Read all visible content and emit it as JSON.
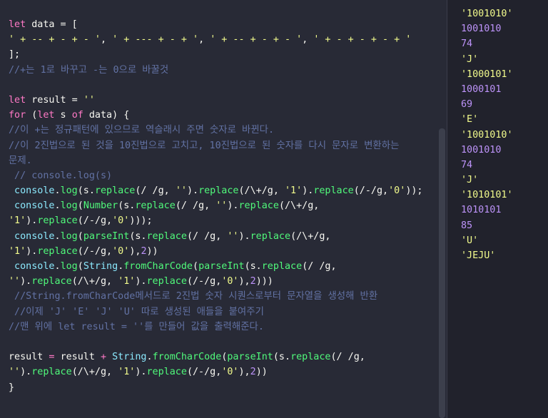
{
  "editor": {
    "lines": [
      [
        {
          "t": "let",
          "c": "kw"
        },
        {
          "t": " data = [",
          "c": "pl"
        }
      ],
      [
        {
          "t": "' + -- + - + - '",
          "c": "str"
        },
        {
          "t": ", ",
          "c": "pl"
        },
        {
          "t": "' + --- + - + '",
          "c": "str"
        },
        {
          "t": ", ",
          "c": "pl"
        },
        {
          "t": "' + -- + - + - '",
          "c": "str"
        },
        {
          "t": ", ",
          "c": "pl"
        },
        {
          "t": "' + - + - + - + '",
          "c": "str"
        }
      ],
      [
        {
          "t": "];",
          "c": "pl"
        }
      ],
      [
        {
          "t": "//+는 1로 바꾸고 -는 0으로 바꿀것",
          "c": "cm"
        }
      ],
      [],
      [
        {
          "t": "let",
          "c": "kw"
        },
        {
          "t": " result = ",
          "c": "pl"
        },
        {
          "t": "''",
          "c": "str"
        }
      ],
      [
        {
          "t": "for",
          "c": "kw"
        },
        {
          "t": " (",
          "c": "pl"
        },
        {
          "t": "let",
          "c": "kw"
        },
        {
          "t": " s ",
          "c": "pl"
        },
        {
          "t": "of",
          "c": "kw"
        },
        {
          "t": " data) {",
          "c": "pl"
        }
      ],
      [
        {
          "t": "//이 +는 정규패턴에 있으므로 역슬래시 주면 숫자로 바뀐다.",
          "c": "cm"
        }
      ],
      [
        {
          "t": "//이 2진법으로 된 것을 10진법으로 고치고, 10진법으로 된 숫자를 다시 문자로 변환하는",
          "c": "cm"
        }
      ],
      [
        {
          "t": "문제.",
          "c": "cm"
        }
      ],
      [
        {
          "t": " // console.log(s)",
          "c": "cm"
        }
      ],
      [
        {
          "t": " console",
          "c": "var"
        },
        {
          "t": ".",
          "c": "pl"
        },
        {
          "t": "log",
          "c": "fn"
        },
        {
          "t": "(s.",
          "c": "pl"
        },
        {
          "t": "replace",
          "c": "fn"
        },
        {
          "t": "(/ /g, ",
          "c": "pl"
        },
        {
          "t": "''",
          "c": "str"
        },
        {
          "t": ").",
          "c": "pl"
        },
        {
          "t": "replace",
          "c": "fn"
        },
        {
          "t": "(/\\+/g, ",
          "c": "pl"
        },
        {
          "t": "'1'",
          "c": "str"
        },
        {
          "t": ").",
          "c": "pl"
        },
        {
          "t": "replace",
          "c": "fn"
        },
        {
          "t": "(/-/g,",
          "c": "pl"
        },
        {
          "t": "'0'",
          "c": "str"
        },
        {
          "t": "));",
          "c": "pl"
        }
      ],
      [
        {
          "t": " console",
          "c": "var"
        },
        {
          "t": ".",
          "c": "pl"
        },
        {
          "t": "log",
          "c": "fn"
        },
        {
          "t": "(",
          "c": "pl"
        },
        {
          "t": "Number",
          "c": "fn"
        },
        {
          "t": "(s.",
          "c": "pl"
        },
        {
          "t": "replace",
          "c": "fn"
        },
        {
          "t": "(/ /g, ",
          "c": "pl"
        },
        {
          "t": "''",
          "c": "str"
        },
        {
          "t": ").",
          "c": "pl"
        },
        {
          "t": "replace",
          "c": "fn"
        },
        {
          "t": "(/\\+/g,",
          "c": "pl"
        }
      ],
      [
        {
          "t": "'1'",
          "c": "str"
        },
        {
          "t": ").",
          "c": "pl"
        },
        {
          "t": "replace",
          "c": "fn"
        },
        {
          "t": "(/-/g,",
          "c": "pl"
        },
        {
          "t": "'0'",
          "c": "str"
        },
        {
          "t": ")));",
          "c": "pl"
        }
      ],
      [
        {
          "t": " console",
          "c": "var"
        },
        {
          "t": ".",
          "c": "pl"
        },
        {
          "t": "log",
          "c": "fn"
        },
        {
          "t": "(",
          "c": "pl"
        },
        {
          "t": "parseInt",
          "c": "fn"
        },
        {
          "t": "(s.",
          "c": "pl"
        },
        {
          "t": "replace",
          "c": "fn"
        },
        {
          "t": "(/ /g, ",
          "c": "pl"
        },
        {
          "t": "''",
          "c": "str"
        },
        {
          "t": ").",
          "c": "pl"
        },
        {
          "t": "replace",
          "c": "fn"
        },
        {
          "t": "(/\\+/g,",
          "c": "pl"
        }
      ],
      [
        {
          "t": "'1'",
          "c": "str"
        },
        {
          "t": ").",
          "c": "pl"
        },
        {
          "t": "replace",
          "c": "fn"
        },
        {
          "t": "(/-/g,",
          "c": "pl"
        },
        {
          "t": "'0'",
          "c": "str"
        },
        {
          "t": "),",
          "c": "pl"
        },
        {
          "t": "2",
          "c": "num"
        },
        {
          "t": "))",
          "c": "pl"
        }
      ],
      [
        {
          "t": " console",
          "c": "var"
        },
        {
          "t": ".",
          "c": "pl"
        },
        {
          "t": "log",
          "c": "fn"
        },
        {
          "t": "(",
          "c": "pl"
        },
        {
          "t": "String",
          "c": "var"
        },
        {
          "t": ".",
          "c": "pl"
        },
        {
          "t": "fromCharCode",
          "c": "fn"
        },
        {
          "t": "(",
          "c": "pl"
        },
        {
          "t": "parseInt",
          "c": "fn"
        },
        {
          "t": "(s.",
          "c": "pl"
        },
        {
          "t": "replace",
          "c": "fn"
        },
        {
          "t": "(/ /g,",
          "c": "pl"
        }
      ],
      [
        {
          "t": "''",
          "c": "str"
        },
        {
          "t": ").",
          "c": "pl"
        },
        {
          "t": "replace",
          "c": "fn"
        },
        {
          "t": "(/\\+/g, ",
          "c": "pl"
        },
        {
          "t": "'1'",
          "c": "str"
        },
        {
          "t": ").",
          "c": "pl"
        },
        {
          "t": "replace",
          "c": "fn"
        },
        {
          "t": "(/-/g,",
          "c": "pl"
        },
        {
          "t": "'0'",
          "c": "str"
        },
        {
          "t": "),",
          "c": "pl"
        },
        {
          "t": "2",
          "c": "num"
        },
        {
          "t": ")))",
          "c": "pl"
        }
      ],
      [
        {
          "t": " //String.fromCharCode메서드로 2진법 숫자 시퀀스로부터 문자열을 생성해 반환",
          "c": "cm"
        }
      ],
      [
        {
          "t": " //이제 'J' 'E' 'J' 'U' 따로 생성된 애들을 붙여주기",
          "c": "cm"
        }
      ],
      [
        {
          "t": "//맨 위에 let result = ''를 만들어 값을 출력해준다.",
          "c": "cm"
        }
      ],
      [],
      [
        {
          "t": "result",
          "c": "pl"
        },
        {
          "t": " = ",
          "c": "kw"
        },
        {
          "t": "result",
          "c": "pl"
        },
        {
          "t": " + ",
          "c": "kw"
        },
        {
          "t": "String",
          "c": "var"
        },
        {
          "t": ".",
          "c": "pl"
        },
        {
          "t": "fromCharCode",
          "c": "fn"
        },
        {
          "t": "(",
          "c": "pl"
        },
        {
          "t": "parseInt",
          "c": "fn"
        },
        {
          "t": "(s.",
          "c": "pl"
        },
        {
          "t": "replace",
          "c": "fn"
        },
        {
          "t": "(/ /g,",
          "c": "pl"
        }
      ],
      [
        {
          "t": "''",
          "c": "str"
        },
        {
          "t": ").",
          "c": "pl"
        },
        {
          "t": "replace",
          "c": "fn"
        },
        {
          "t": "(/\\+/g, ",
          "c": "pl"
        },
        {
          "t": "'1'",
          "c": "str"
        },
        {
          "t": ").",
          "c": "pl"
        },
        {
          "t": "replace",
          "c": "fn"
        },
        {
          "t": "(/-/g,",
          "c": "pl"
        },
        {
          "t": "'0'",
          "c": "str"
        },
        {
          "t": "),",
          "c": "pl"
        },
        {
          "t": "2",
          "c": "num"
        },
        {
          "t": "))",
          "c": "pl"
        }
      ],
      [
        {
          "t": "}",
          "c": "pl"
        }
      ]
    ]
  },
  "console": {
    "lines": [
      {
        "text": "'1001010'",
        "type": "string"
      },
      {
        "text": "1001010",
        "type": "number"
      },
      {
        "text": "74",
        "type": "number"
      },
      {
        "text": "'J'",
        "type": "string"
      },
      {
        "text": "'1000101'",
        "type": "string"
      },
      {
        "text": "1000101",
        "type": "number"
      },
      {
        "text": "69",
        "type": "number"
      },
      {
        "text": "'E'",
        "type": "string"
      },
      {
        "text": "'1001010'",
        "type": "string"
      },
      {
        "text": "1001010",
        "type": "number"
      },
      {
        "text": "74",
        "type": "number"
      },
      {
        "text": "'J'",
        "type": "string"
      },
      {
        "text": "'1010101'",
        "type": "string"
      },
      {
        "text": "1010101",
        "type": "number"
      },
      {
        "text": "85",
        "type": "number"
      },
      {
        "text": "'U'",
        "type": "string"
      },
      {
        "text": "'JEJU'",
        "type": "string"
      }
    ]
  },
  "theme": {
    "background": "#282a36",
    "console_background": "#21222c",
    "keyword": "#ff79c6",
    "string": "#f1fa8c",
    "number": "#bd93f9",
    "function": "#50fa7b",
    "builtin": "#8be9fd",
    "comment": "#6272a4",
    "text": "#f8f8f2"
  }
}
